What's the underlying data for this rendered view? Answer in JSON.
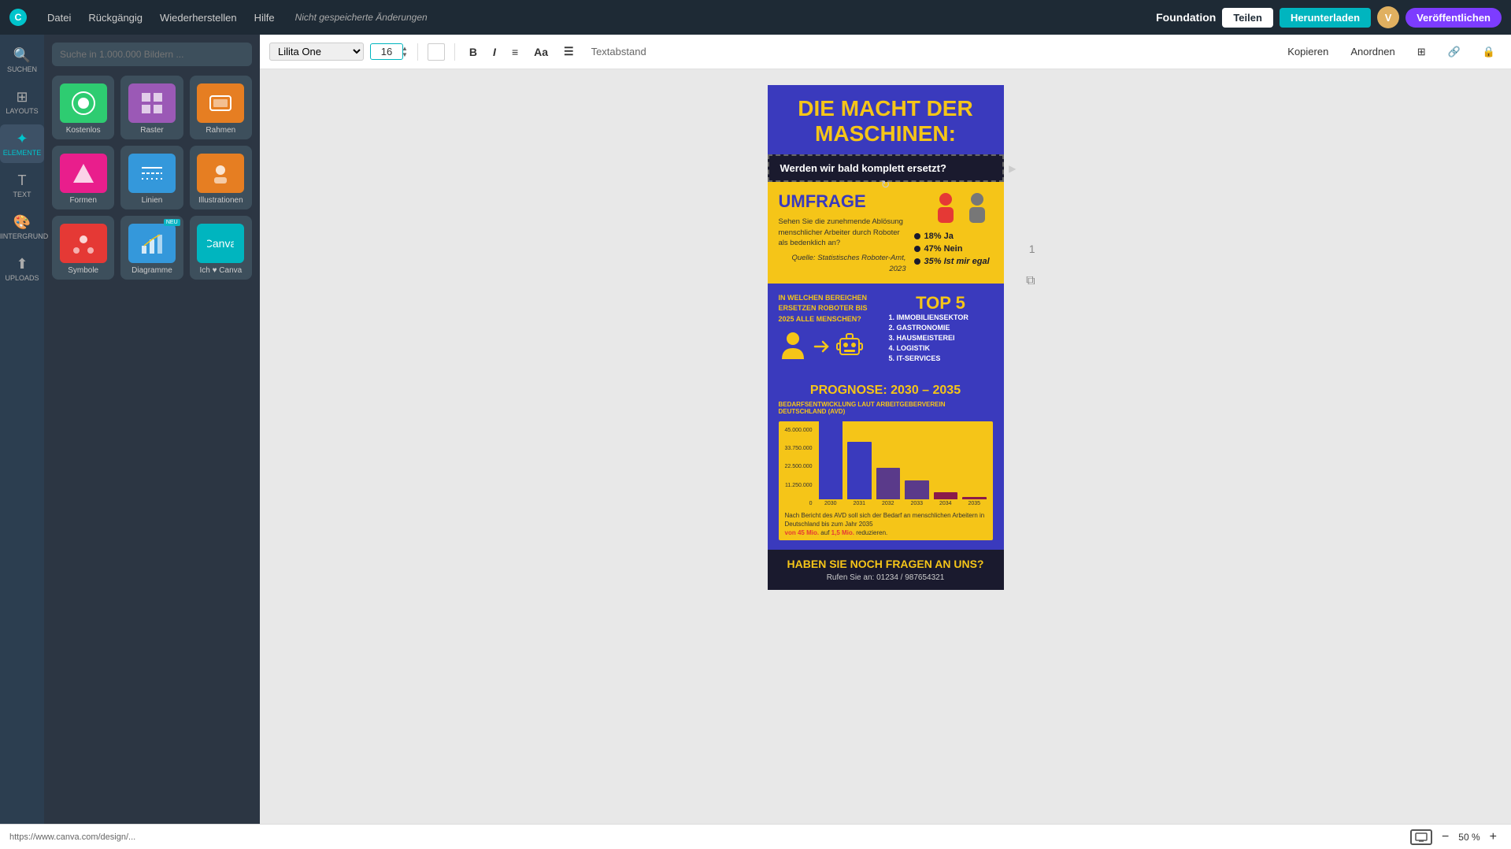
{
  "app": {
    "name": "Canva",
    "logo_text": "Canva"
  },
  "topbar": {
    "menu_items": [
      "Datei",
      "Rückgängig",
      "Wiederherstellen",
      "Hilfe"
    ],
    "unsaved_label": "Nicht gespeicherte Änderungen",
    "foundation_label": "Foundation",
    "teilen_label": "Teilen",
    "herunterladen_label": "Herunterladen",
    "veroeffentlichen_label": "Veröffentlichen",
    "avatar_text": "V"
  },
  "toolbar": {
    "font_name": "Lilita One",
    "font_size": "16",
    "textabstand_label": "Textabstand",
    "kopieren_label": "Kopieren",
    "anordnen_label": "Anordnen",
    "bold_label": "B",
    "italic_label": "I"
  },
  "sidebar": {
    "items": [
      {
        "id": "suchen",
        "label": "SUCHEN",
        "icon": "🔍"
      },
      {
        "id": "layouts",
        "label": "LAYOUTS",
        "icon": "⊞"
      },
      {
        "id": "elemente",
        "label": "ELEMENTE",
        "icon": "✦"
      },
      {
        "id": "text",
        "label": "TEXT",
        "icon": "T"
      },
      {
        "id": "hintergrund",
        "label": "HINTERGRUND",
        "icon": "🎨"
      },
      {
        "id": "uploads",
        "label": "UPLOADS",
        "icon": "⬆"
      }
    ]
  },
  "panel": {
    "search_placeholder": "Suche in 1.000.000 Bildern ...",
    "elements": [
      {
        "label": "Kostenlos",
        "thumb_color": "#2ecc71"
      },
      {
        "label": "Raster",
        "thumb_color": "#9b59b6"
      },
      {
        "label": "Rahmen",
        "thumb_color": "#e67e22"
      },
      {
        "label": "Formen",
        "thumb_color": "#e91e8c"
      },
      {
        "label": "Linien",
        "thumb_color": "#3498db"
      },
      {
        "label": "Illustrationen",
        "thumb_color": "#e67e22"
      },
      {
        "label": "Symbole",
        "thumb_color": "#e53935"
      },
      {
        "label": "Diagramme",
        "thumb_color": "#3498db"
      },
      {
        "label": "Ich ♥ Canva",
        "thumb_color": "#00b5bf"
      }
    ]
  },
  "infographic": {
    "title_line1": "DIE MACHT DER",
    "title_line2": "MASCHINEN:",
    "subtitle": "Werden wir bald komplett ersetzt?",
    "umfrage_title": "UMFRAGE",
    "umfrage_question": "Sehen Sie die zunehmende Ablösung menschlicher Arbeiter durch Roboter als bedenklich an?",
    "stats": [
      {
        "pct": "18% Ja",
        "dot": true
      },
      {
        "pct": "47% Nein",
        "dot": true
      },
      {
        "pct": "35% Ist mir egal",
        "dot": true,
        "italic": true
      }
    ],
    "source": "Quelle: Statistisches Roboter-Amt, 2023",
    "top5_question": "IN WELCHEN BEREICHEN ERSETZEN ROBOTER BIS 2025 ALLE MENSCHEN?",
    "top5_title": "TOP 5",
    "top5_items": [
      "1. IMMOBILIENSEKTOR",
      "2. GASTRONOMIE",
      "3. HAUSMEISTEREI",
      "4. LOGISTIK",
      "5. IT-SERVICES"
    ],
    "prognose_title": "PROGNOSE: 2030 – 2035",
    "prognose_subtitle": "BEDARFSENTWICKLUNG LAUT ARBEITGEBERVEREIN DEUTSCHLAND (AVD)",
    "chart_y_labels": [
      "45.000.000",
      "33.750.000",
      "22.500.000",
      "11.250.000",
      "0"
    ],
    "chart_bars": [
      {
        "year": "2030",
        "value": 45000000,
        "color": "#3a3abd"
      },
      {
        "year": "2031",
        "value": 33000000,
        "color": "#3a3abd"
      },
      {
        "year": "2032",
        "value": 18000000,
        "color": "#5a3a8a"
      },
      {
        "year": "2033",
        "value": 11000000,
        "color": "#5a3a8a"
      },
      {
        "year": "2034",
        "value": 4000000,
        "color": "#8a1a4a"
      },
      {
        "year": "2035",
        "value": 1500000,
        "color": "#8a1a4a"
      }
    ],
    "chart_note": "Nach Bericht des AVD soll sich der Bedarf an menschlichen Arbeitern in Deutschland bis zum Jahr 2035",
    "chart_note_highlight1": "von 45 Mio.",
    "chart_note_mid": " auf ",
    "chart_note_highlight2": "1,5 Mio.",
    "chart_note_end": " reduzieren.",
    "footer_title": "HABEN SIE NOCH FRAGEN AN UNS?",
    "footer_sub": "Rufen Sie an: 01234 / 987654321"
  },
  "zoom": {
    "level": "50 %",
    "decrease_label": "−",
    "increase_label": "+"
  },
  "bottom_bar": {
    "url": "https://www.canva.com/design/..."
  },
  "page_number": "1"
}
